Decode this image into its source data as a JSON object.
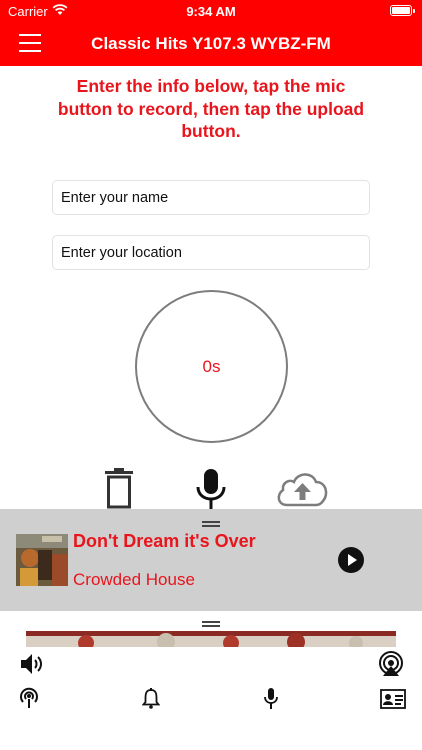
{
  "status_bar": {
    "carrier": "Carrier",
    "time": "9:34 AM"
  },
  "nav": {
    "title": "Classic Hits Y107.3 WYBZ-FM"
  },
  "instructions": "Enter the info below, tap the mic button to record, then tap the upload button.",
  "form": {
    "name_placeholder": "Enter your name",
    "location_placeholder": "Enter your location"
  },
  "recorder": {
    "elapsed": "0s"
  },
  "now_playing": {
    "title": "Don't Dream it's Over",
    "artist": "Crowded House"
  },
  "colors": {
    "brand_red": "#ff0000",
    "accent_text": "#e8151d",
    "player_bg": "#cfcfcf",
    "circle_border": "#7d7d7d"
  },
  "icons": {
    "controls": [
      "trash-icon",
      "microphone-icon",
      "cloud-upload-icon"
    ],
    "audio_bar": [
      "volume-icon",
      "airplay-icon"
    ],
    "tab_bar": [
      "podcast-icon",
      "bell-icon",
      "microphone-icon",
      "contact-card-icon"
    ]
  }
}
